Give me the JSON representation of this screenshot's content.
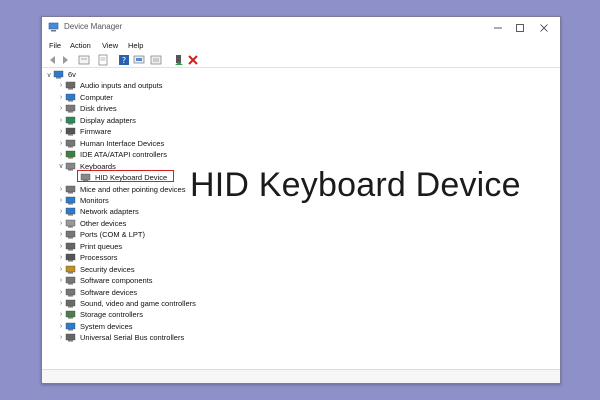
{
  "window": {
    "title": "Device Manager"
  },
  "menu": [
    "File",
    "Action",
    "View",
    "Help"
  ],
  "tree": {
    "root": "6v",
    "items": [
      {
        "label": "Audio inputs and outputs",
        "icon": "speaker-icon",
        "color": "#6a6a6a"
      },
      {
        "label": "Computer",
        "icon": "monitor-icon",
        "color": "#2b7bd0"
      },
      {
        "label": "Disk drives",
        "icon": "disk-icon",
        "color": "#7a7a7a"
      },
      {
        "label": "Display adapters",
        "icon": "display-icon",
        "color": "#2e8b57"
      },
      {
        "label": "Firmware",
        "icon": "chip-icon",
        "color": "#555555"
      },
      {
        "label": "Human Interface Devices",
        "icon": "hid-icon",
        "color": "#777777"
      },
      {
        "label": "IDE ATA/ATAPI controllers",
        "icon": "controller-icon",
        "color": "#3f7f3f"
      },
      {
        "label": "Keyboards",
        "icon": "keyboard-icon",
        "color": "#888888",
        "expanded": true,
        "children": [
          {
            "label": "HID Keyboard Device",
            "icon": "keyboard-icon",
            "color": "#888888"
          }
        ]
      },
      {
        "label": "Mice and other pointing devices",
        "icon": "mouse-icon",
        "color": "#777777"
      },
      {
        "label": "Monitors",
        "icon": "monitor-icon",
        "color": "#2b7bd0"
      },
      {
        "label": "Network adapters",
        "icon": "network-icon",
        "color": "#2b7bd0"
      },
      {
        "label": "Other devices",
        "icon": "unknown-device-icon",
        "color": "#999999"
      },
      {
        "label": "Ports (COM & LPT)",
        "icon": "port-icon",
        "color": "#777777"
      },
      {
        "label": "Print queues",
        "icon": "printer-icon",
        "color": "#666666"
      },
      {
        "label": "Processors",
        "icon": "cpu-icon",
        "color": "#555555"
      },
      {
        "label": "Security devices",
        "icon": "security-icon",
        "color": "#c09020"
      },
      {
        "label": "Software components",
        "icon": "component-icon",
        "color": "#777777"
      },
      {
        "label": "Software devices",
        "icon": "component-icon",
        "color": "#777777"
      },
      {
        "label": "Sound, video and game controllers",
        "icon": "speaker-icon",
        "color": "#6a6a6a"
      },
      {
        "label": "Storage controllers",
        "icon": "storage-icon",
        "color": "#4a7f4a"
      },
      {
        "label": "System devices",
        "icon": "system-icon",
        "color": "#2b7bd0"
      },
      {
        "label": "Universal Serial Bus controllers",
        "icon": "usb-icon",
        "color": "#666666"
      }
    ]
  },
  "callout": {
    "text": "HID Keyboard Device",
    "box_color": "#d42020"
  }
}
